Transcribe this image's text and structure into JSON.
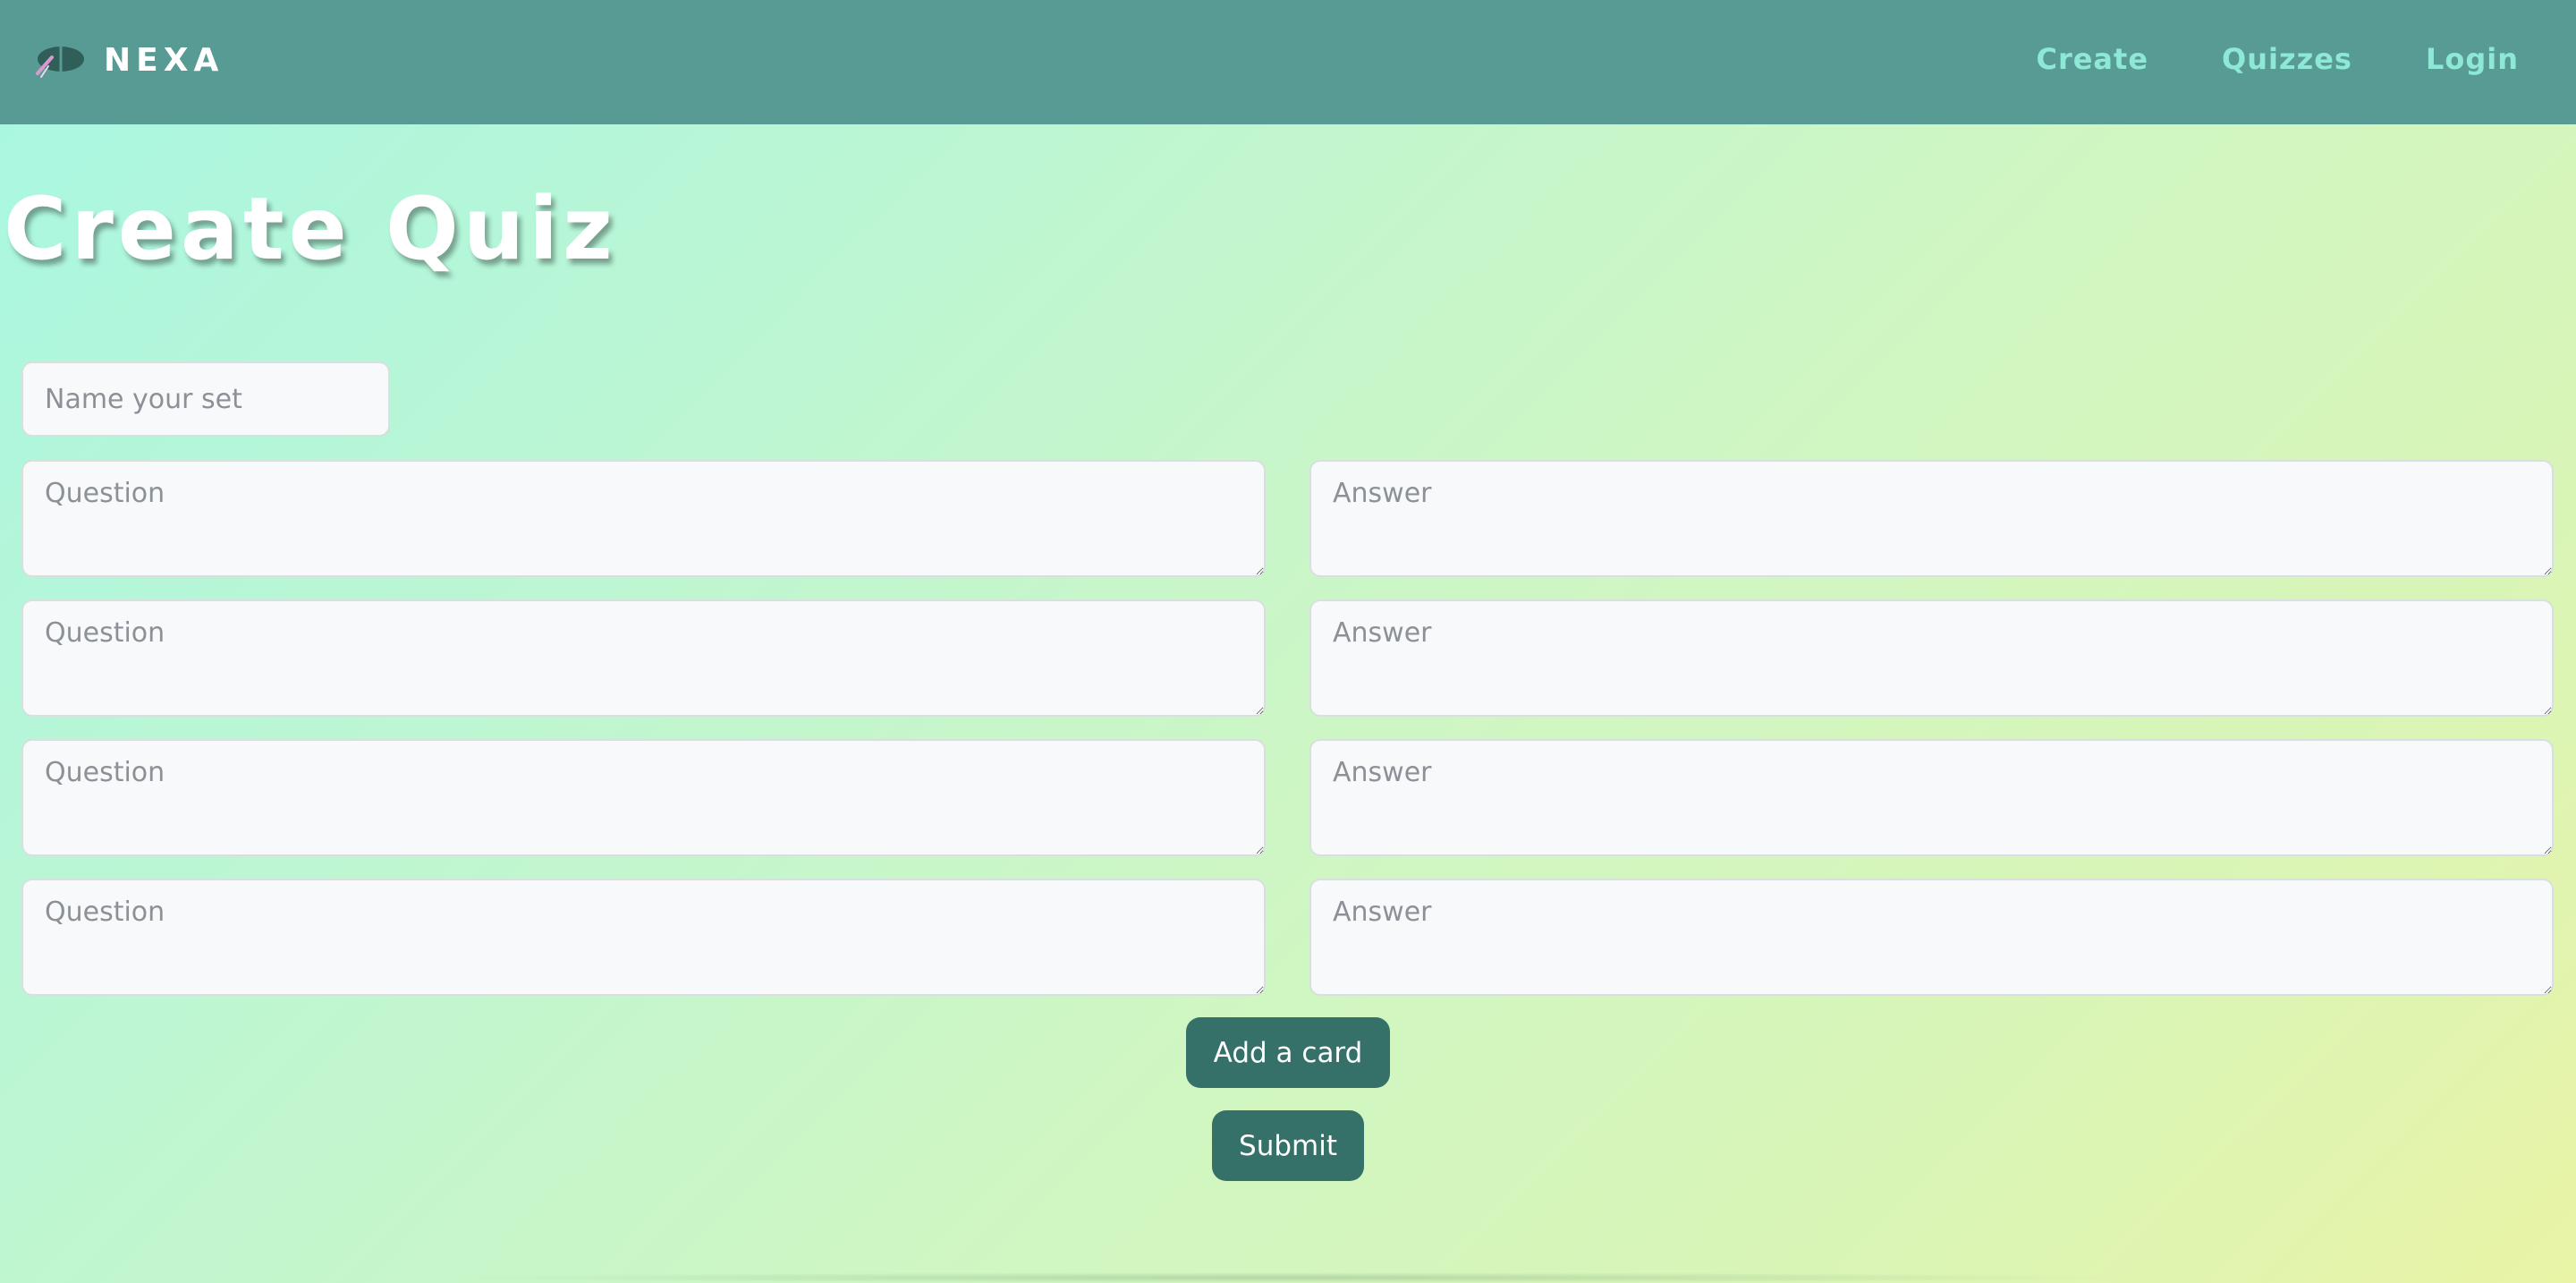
{
  "brand": {
    "name": "NEXA",
    "logo_icon": "nexa-logo-icon"
  },
  "nav": {
    "items": [
      {
        "label": "Create"
      },
      {
        "label": "Quizzes"
      },
      {
        "label": "Login"
      }
    ]
  },
  "page": {
    "title": "Create Quiz"
  },
  "form": {
    "set_name": {
      "placeholder": "Name your set",
      "value": ""
    },
    "cards": [
      {
        "question_placeholder": "Question",
        "answer_placeholder": "Answer"
      },
      {
        "question_placeholder": "Question",
        "answer_placeholder": "Answer"
      },
      {
        "question_placeholder": "Question",
        "answer_placeholder": "Answer"
      },
      {
        "question_placeholder": "Question",
        "answer_placeholder": "Answer"
      }
    ],
    "add_card_label": "Add a card",
    "submit_label": "Submit"
  },
  "colors": {
    "navbar": "#589b94",
    "nav_link": "#8ee8d6",
    "button": "#357069",
    "title": "#ffffff"
  }
}
